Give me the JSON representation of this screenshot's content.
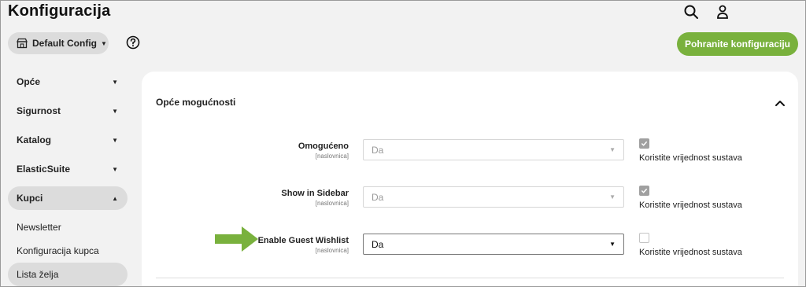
{
  "header": {
    "title": "Konfiguracija",
    "icons": [
      "search-icon",
      "user-icon"
    ]
  },
  "toolbar": {
    "scope_label": "Default Config",
    "scope_icon": "store-icon",
    "help_icon": "help-icon",
    "save_label": "Pohranite konfiguraciju"
  },
  "sidebar": {
    "items": [
      {
        "label": "Opće",
        "expanded": false
      },
      {
        "label": "Sigurnost",
        "expanded": false
      },
      {
        "label": "Katalog",
        "expanded": false
      },
      {
        "label": "ElasticSuite",
        "expanded": false
      },
      {
        "label": "Kupci",
        "expanded": true
      }
    ],
    "subitems": [
      {
        "label": "Newsletter"
      },
      {
        "label": "Konfiguracija kupca"
      },
      {
        "label": "Lista želja",
        "selected": true
      }
    ]
  },
  "section": {
    "title": "Opće mogućnosti",
    "expanded": true,
    "fields": [
      {
        "label": "Omogućeno",
        "scope": "[naslovnica]",
        "value": "Da",
        "disabled": true,
        "use_system_checked": true,
        "use_system_label": "Koristite vrijednost sustava"
      },
      {
        "label": "Show in Sidebar",
        "scope": "[naslovnica]",
        "value": "Da",
        "disabled": true,
        "use_system_checked": true,
        "use_system_label": "Koristite vrijednost sustava"
      },
      {
        "label": "Enable Guest Wishlist",
        "scope": "[naslovnica]",
        "value": "Da",
        "disabled": false,
        "use_system_checked": false,
        "use_system_label": "Koristite vrijednost sustava"
      }
    ]
  },
  "colors": {
    "accent_green": "#79b13d",
    "annotation_arrow": "#79b13d",
    "pill_gray": "#dcdcdc"
  }
}
